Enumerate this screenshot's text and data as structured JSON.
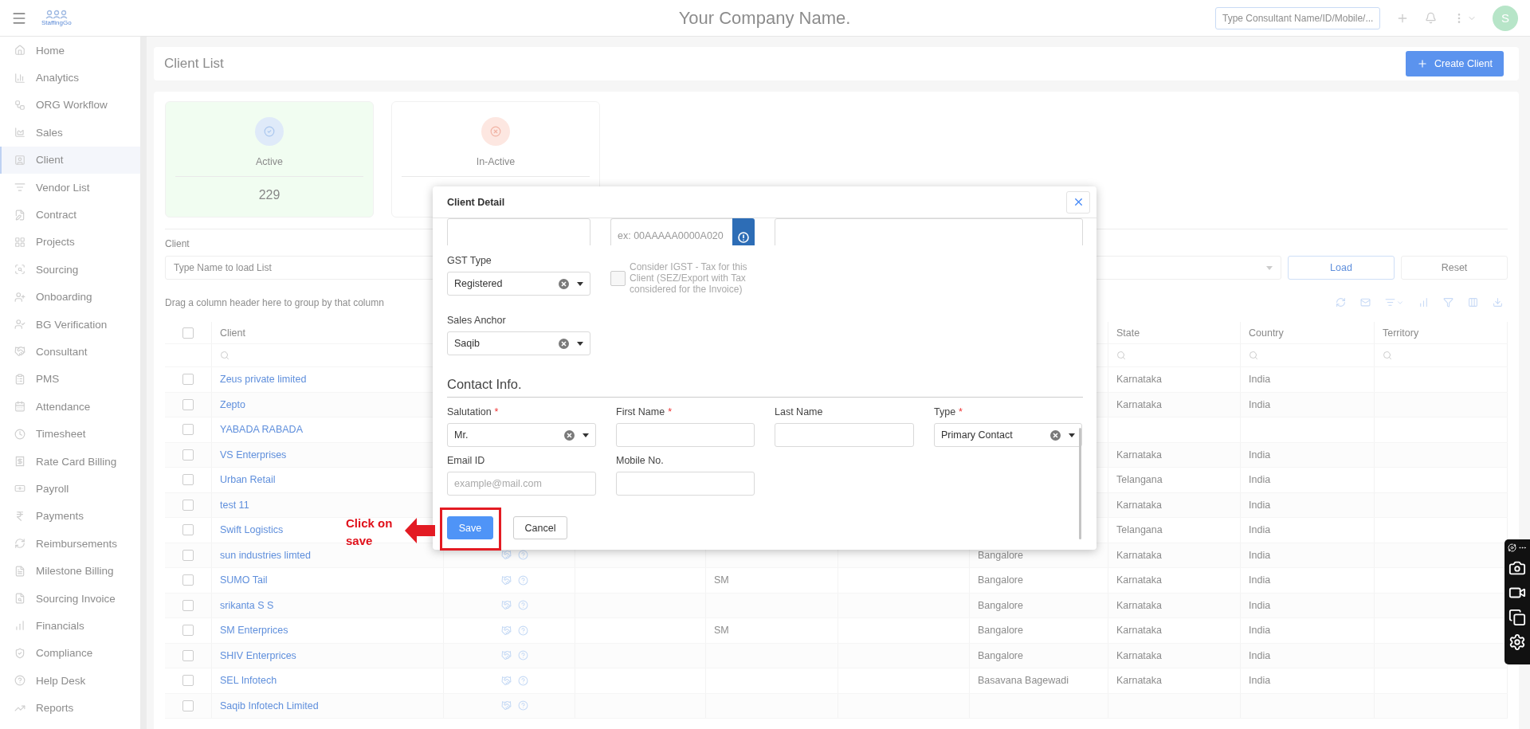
{
  "topbar": {
    "logo_text": "StaffingGo",
    "company_name": "Your Company Name.",
    "search": {
      "placeholder": "Type Consultant Name/ID/Mobile/..."
    },
    "avatar": "S"
  },
  "sidebar": {
    "items": [
      {
        "label": "Home",
        "selected": false
      },
      {
        "label": "Analytics",
        "selected": false
      },
      {
        "label": "ORG Workflow",
        "selected": false
      },
      {
        "label": "Sales",
        "selected": false
      },
      {
        "label": "Client",
        "selected": true
      },
      {
        "label": "Vendor List",
        "selected": false
      },
      {
        "label": "Contract",
        "selected": false
      },
      {
        "label": "Projects",
        "selected": false
      },
      {
        "label": "Sourcing",
        "selected": false
      },
      {
        "label": "Onboarding",
        "selected": false
      },
      {
        "label": "BG Verification",
        "selected": false
      },
      {
        "label": "Consultant",
        "selected": false
      },
      {
        "label": "PMS",
        "selected": false
      },
      {
        "label": "Attendance",
        "selected": false
      },
      {
        "label": "Timesheet",
        "selected": false
      },
      {
        "label": "Rate Card Billing",
        "selected": false
      },
      {
        "label": "Payroll",
        "selected": false
      },
      {
        "label": "Payments",
        "selected": false
      },
      {
        "label": "Reimbursements",
        "selected": false
      },
      {
        "label": "Milestone Billing",
        "selected": false
      },
      {
        "label": "Sourcing Invoice",
        "selected": false
      },
      {
        "label": "Financials",
        "selected": false
      },
      {
        "label": "Compliance",
        "selected": false
      },
      {
        "label": "Help Desk",
        "selected": false
      },
      {
        "label": "Reports",
        "selected": false
      }
    ]
  },
  "page": {
    "title": "Client List",
    "create_button": "Create Client"
  },
  "stats": [
    {
      "kind": "active",
      "label": "Active",
      "count": "229"
    },
    {
      "kind": "inactive",
      "label": "In-Active"
    }
  ],
  "filter": {
    "label": "Client",
    "placeholder": "Type Name to load List",
    "buttons": [
      "Load",
      "Reset"
    ]
  },
  "table": {
    "group_hint": "Drag a column header here to group by that column",
    "select_all": {
      "checked": false
    },
    "headers": {
      "client": "Client",
      "state": "State",
      "country": "Country",
      "territory": "Territory"
    },
    "rows": [
      {
        "checked": false,
        "client": "Zeus private limited",
        "actions": false,
        "state": "Karnataka",
        "country": "India"
      },
      {
        "checked": false,
        "client": "Zepto",
        "actions": false,
        "state": "Karnataka",
        "country": "India"
      },
      {
        "checked": false,
        "client": "YABADA RABADA",
        "actions": false
      },
      {
        "checked": false,
        "client": "VS Enterprises",
        "actions": false,
        "state": "Karnataka",
        "country": "India"
      },
      {
        "checked": false,
        "client": "Urban Retail",
        "actions": false,
        "state": "Telangana",
        "country": "India"
      },
      {
        "checked": false,
        "client": "test 11",
        "actions": false,
        "state": "Karnataka",
        "country": "India"
      },
      {
        "checked": false,
        "client": "Swift Logistics",
        "actions": false,
        "state": "Telangana",
        "country": "India"
      },
      {
        "checked": false,
        "client": "sun industries limted",
        "actions": true,
        "column_7": "Bangalore",
        "state": "Karnataka",
        "country": "India"
      },
      {
        "checked": false,
        "client": "SUMO Tail",
        "actions": true,
        "column_5": "SM",
        "column_7": "Bangalore",
        "state": "Karnataka",
        "country": "India"
      },
      {
        "checked": false,
        "client": "srikanta S S",
        "actions": true,
        "column_7": "Bangalore",
        "state": "Karnataka",
        "country": "India"
      },
      {
        "checked": false,
        "client": "SM Enterprices",
        "actions": true,
        "column_5": "SM",
        "column_7": "Bangalore",
        "state": "Karnataka",
        "country": "India"
      },
      {
        "checked": false,
        "client": "SHIV Enterprices",
        "actions": true,
        "column_7": "Bangalore",
        "state": "Karnataka",
        "country": "India"
      },
      {
        "checked": false,
        "client": "SEL Infotech",
        "actions": true,
        "column_7": "Basavana Bagewadi",
        "state": "Karnataka",
        "country": "India"
      },
      {
        "checked": false,
        "client": "Saqib Infotech Limited",
        "actions": true
      }
    ]
  },
  "modal": {
    "title": "Client Detail",
    "partial_fields": [
      {
        "kind": "input"
      },
      {
        "kind": "input_button",
        "placeholder": "ex: 00AAAAA0000A020"
      },
      {
        "kind": "input"
      }
    ],
    "gst_type": {
      "label": "GST Type",
      "value": "Registered"
    },
    "igst": {
      "checked": false,
      "disabled": true,
      "label": "Consider IGST - Tax for this Client (SEZ/Export with Tax considered for the Invoice)"
    },
    "sales_anchor": {
      "label": "Sales Anchor",
      "value": "Saqib"
    },
    "contact_title": "Contact Info.",
    "contact_fields": [
      {
        "kind": "select",
        "label": "Salutation",
        "mark": "*",
        "value": "Mr."
      },
      {
        "kind": "input",
        "label": "First Name",
        "mark": "*"
      },
      {
        "kind": "input",
        "label": "Last Name"
      },
      {
        "kind": "select",
        "label": "Type",
        "mark": "*",
        "value": "Primary Contact"
      },
      {
        "kind": "input",
        "label": "Email ID",
        "placeholder": "example@mail.com"
      },
      {
        "kind": "input",
        "label": "Mobile No."
      }
    ],
    "buttons": [
      {
        "kind": "primary",
        "label": "Save"
      },
      {
        "kind": "secondary",
        "label": "Cancel"
      }
    ]
  },
  "callout": {
    "text": "Click on save"
  }
}
